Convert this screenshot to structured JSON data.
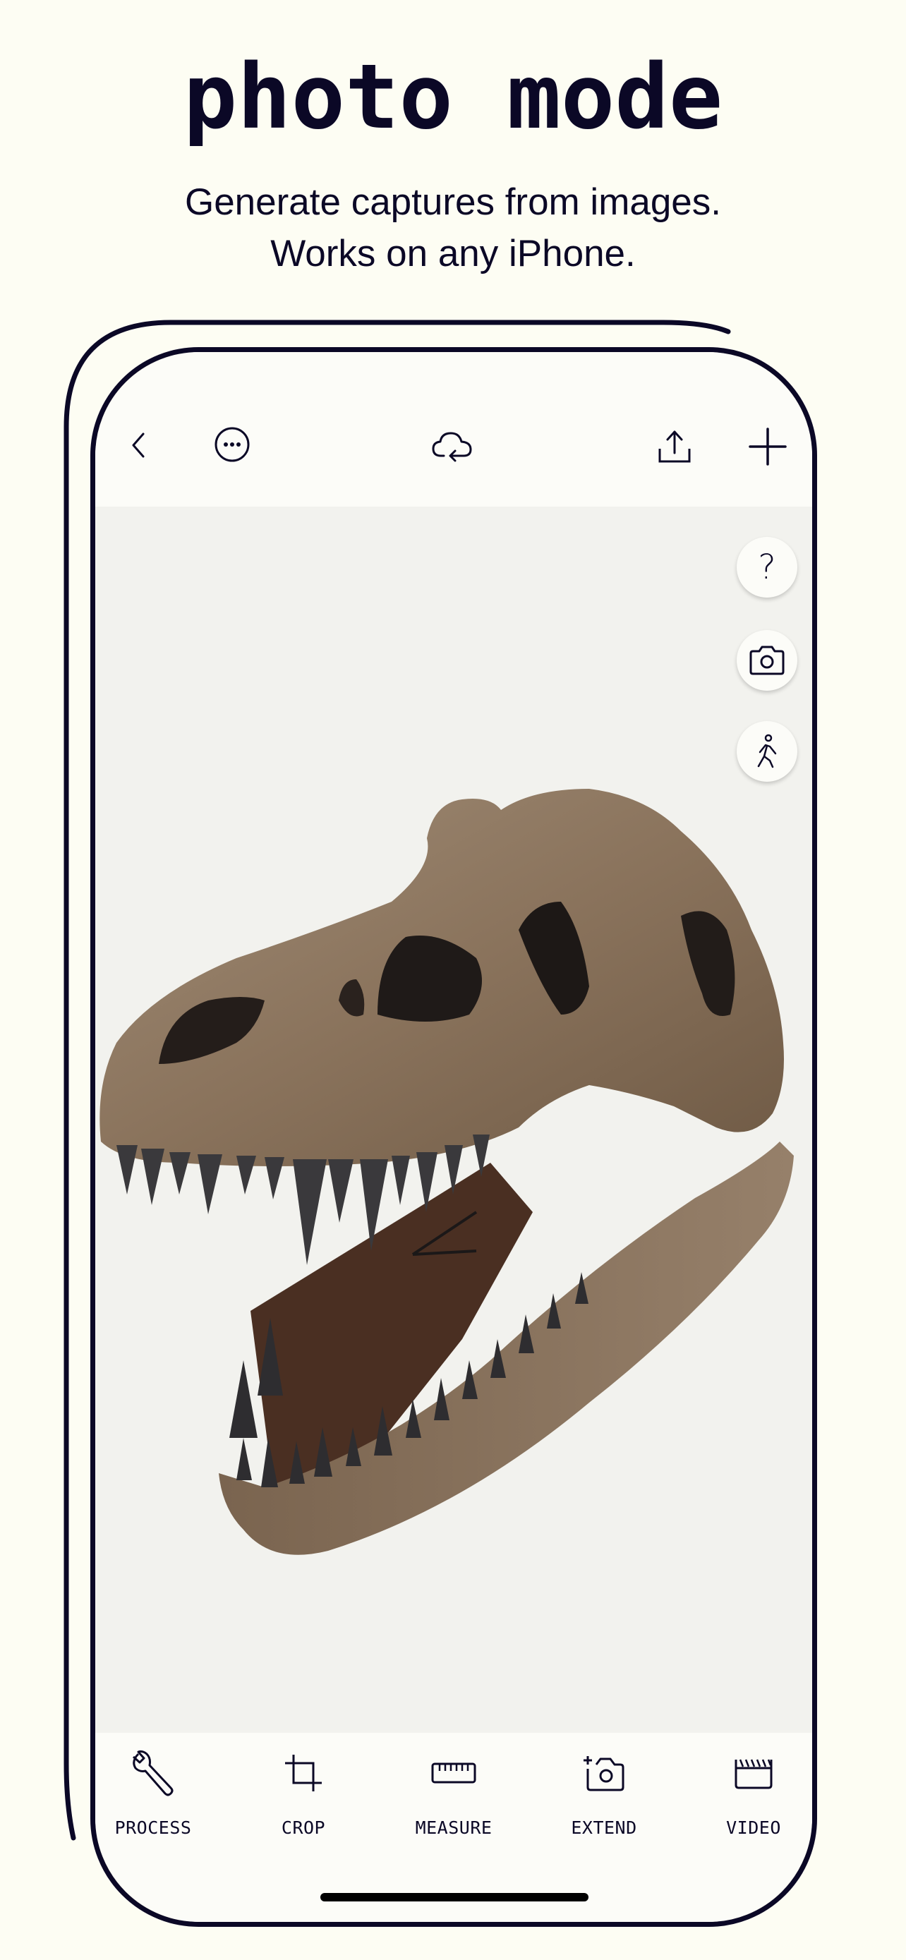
{
  "page": {
    "title": "photo mode",
    "subtitle_lines": [
      "Generate captures from images.",
      "Works on any iPhone."
    ]
  },
  "colors": {
    "background": "#fdfdf3",
    "ink": "#0b0826",
    "screen": "#fcfcf8",
    "viewer": "#f2f2ee"
  },
  "app": {
    "header": {
      "left_buttons": [
        {
          "name": "back",
          "icon": "chevron-left-icon"
        },
        {
          "name": "more",
          "icon": "ellipsis-circle-icon"
        }
      ],
      "center_button": {
        "name": "cloud-sync",
        "icon": "cloud-sync-icon"
      },
      "right_buttons": [
        {
          "name": "share",
          "icon": "share-icon"
        },
        {
          "name": "add",
          "icon": "plus-icon"
        }
      ]
    },
    "viewer": {
      "subject": "T. rex skull 3D capture",
      "floating_buttons": [
        {
          "name": "help",
          "icon": "question-icon",
          "glyph": "?"
        },
        {
          "name": "snapshot",
          "icon": "camera-icon"
        },
        {
          "name": "walk-mode",
          "icon": "walking-person-icon"
        }
      ]
    },
    "toolbar": {
      "items": [
        {
          "label": "PROCESS",
          "icon": "wrench-icon"
        },
        {
          "label": "CROP",
          "icon": "crop-icon"
        },
        {
          "label": "MEASURE",
          "icon": "ruler-icon"
        },
        {
          "label": "EXTEND",
          "icon": "camera-plus-icon"
        },
        {
          "label": "VIDEO",
          "icon": "clapperboard-icon"
        }
      ]
    }
  }
}
